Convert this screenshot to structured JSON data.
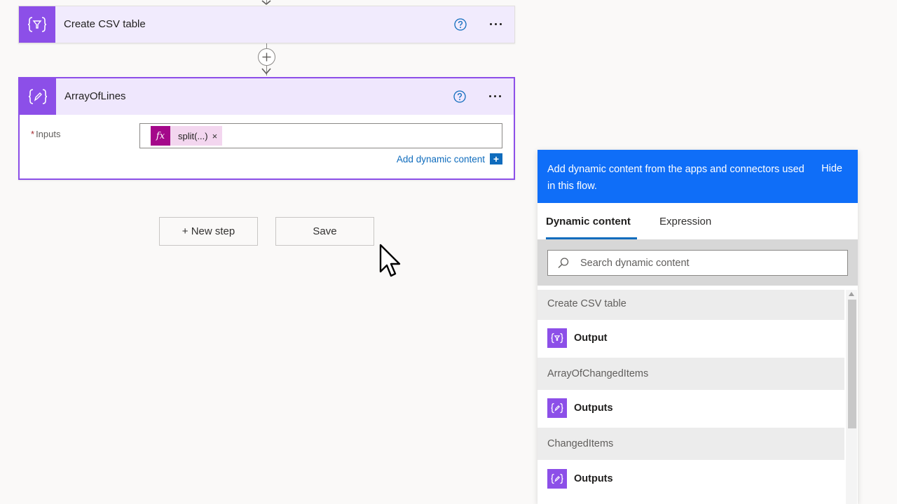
{
  "flow": {
    "steps": [
      {
        "title": "Create CSV table",
        "icon": "data-operation-icon"
      },
      {
        "title": "ArrayOfLines",
        "icon": "compose-icon",
        "inputs": {
          "label": "Inputs",
          "required_marker": "*",
          "token": {
            "icon": "fx-icon",
            "label": "split(...)",
            "remove": "×"
          }
        },
        "add_dynamic_label": "Add dynamic content",
        "add_dynamic_icon": "+"
      }
    ],
    "new_step_label": "+ New step",
    "save_label": "Save"
  },
  "dynamic_panel": {
    "banner": "Add dynamic content from the apps and connectors used in this flow.",
    "hide_label": "Hide",
    "tabs": [
      {
        "label": "Dynamic content",
        "active": true
      },
      {
        "label": "Expression",
        "active": false
      }
    ],
    "search": {
      "placeholder": "Search dynamic content"
    },
    "groups": [
      {
        "name": "Create CSV table",
        "items": [
          {
            "label": "Output",
            "icon": "data-operation-icon"
          }
        ]
      },
      {
        "name": "ArrayOfChangedItems",
        "items": [
          {
            "label": "Outputs",
            "icon": "compose-icon"
          }
        ]
      },
      {
        "name": "ChangedItems",
        "items": [
          {
            "label": "Outputs",
            "icon": "compose-icon"
          }
        ]
      }
    ]
  },
  "colors": {
    "accent_purple": "#8c4fe8",
    "banner_blue": "#0f6ef8",
    "link_blue": "#0f6cbd",
    "fx_magenta": "#a4088a"
  }
}
